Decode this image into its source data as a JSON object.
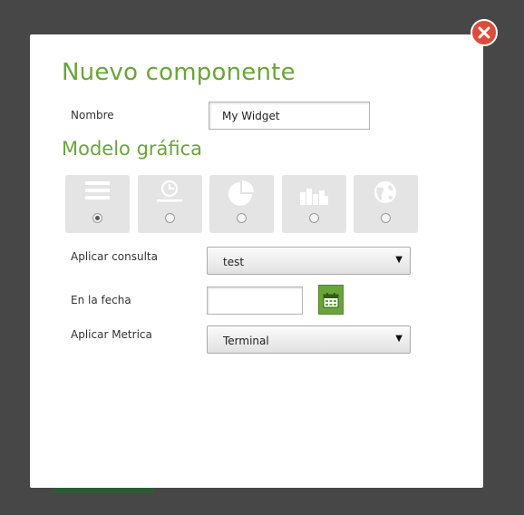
{
  "dialog": {
    "title": "Nuevo componente",
    "name_label": "Nombre",
    "name_value": "My Widget",
    "chart_model_heading": "Modelo gráfica",
    "chart_types": [
      {
        "icon": "list-icon",
        "selected": true
      },
      {
        "icon": "timeline-icon",
        "selected": false
      },
      {
        "icon": "pie-chart-icon",
        "selected": false
      },
      {
        "icon": "bar-chart-icon",
        "selected": false
      },
      {
        "icon": "globe-icon",
        "selected": false
      }
    ],
    "query_label": "Aplicar consulta",
    "query_value": "test",
    "date_label": "En la fecha",
    "date_value": "",
    "metric_label": "Aplicar Metrica",
    "metric_value": "Terminal",
    "dropdown_arrow": "▼"
  },
  "colors": {
    "accent": "#6aa53b",
    "close": "#e04a3a",
    "backdrop": "#474747"
  }
}
